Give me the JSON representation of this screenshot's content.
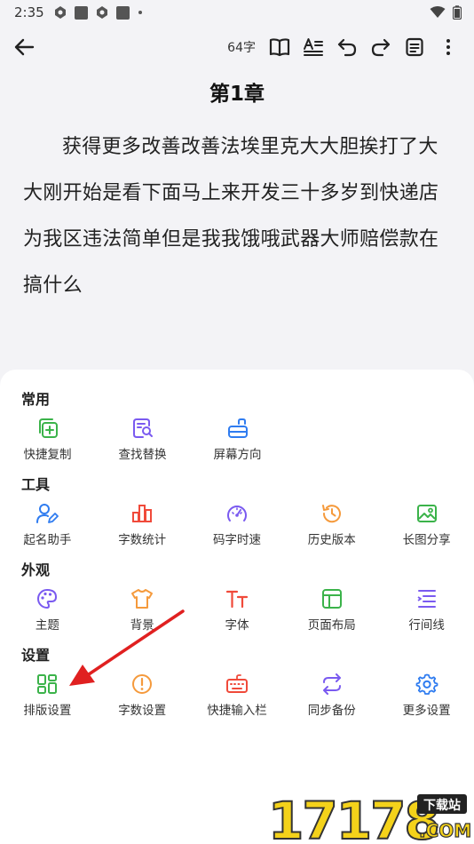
{
  "status": {
    "time": "2:35"
  },
  "toolbar": {
    "word_count": "64字"
  },
  "chapter": {
    "title": "第1章",
    "body": "获得更多改善改善法埃里克大大胆挨打了大大刚开始是看下面马上来开发三十多岁到快递店为我区违法简单但是我我饿哦武器大师赔偿款在搞什么"
  },
  "panel": {
    "sections": [
      {
        "title": "常用",
        "items": [
          {
            "label": "快捷复制",
            "icon": "copy-plus-icon",
            "color": "#3bb34a"
          },
          {
            "label": "查找替换",
            "icon": "find-replace-icon",
            "color": "#7a5af0"
          },
          {
            "label": "屏幕方向",
            "icon": "screen-rotate-icon",
            "color": "#2f7cf0"
          }
        ]
      },
      {
        "title": "工具",
        "items": [
          {
            "label": "起名助手",
            "icon": "naming-assistant-icon",
            "color": "#2f7cf0"
          },
          {
            "label": "字数统计",
            "icon": "bar-chart-icon",
            "color": "#f04a3a"
          },
          {
            "label": "码字时速",
            "icon": "speedometer-icon",
            "color": "#7a5af0"
          },
          {
            "label": "历史版本",
            "icon": "history-icon",
            "color": "#f59a3c"
          },
          {
            "label": "长图分享",
            "icon": "image-share-icon",
            "color": "#3bb34a"
          }
        ]
      },
      {
        "title": "外观",
        "items": [
          {
            "label": "主题",
            "icon": "palette-icon",
            "color": "#7a5af0"
          },
          {
            "label": "背景",
            "icon": "shirt-icon",
            "color": "#f59a3c"
          },
          {
            "label": "字体",
            "icon": "font-icon",
            "color": "#f04a3a"
          },
          {
            "label": "页面布局",
            "icon": "layout-icon",
            "color": "#3bb34a"
          },
          {
            "label": "行间线",
            "icon": "line-spacing-icon",
            "color": "#7a5af0"
          }
        ]
      },
      {
        "title": "设置",
        "items": [
          {
            "label": "排版设置",
            "icon": "grid-layout-icon",
            "color": "#3bb34a"
          },
          {
            "label": "字数设置",
            "icon": "alert-circle-icon",
            "color": "#f59a3c"
          },
          {
            "label": "快捷输入栏",
            "icon": "keyboard-icon",
            "color": "#f04a3a"
          },
          {
            "label": "同步备份",
            "icon": "sync-icon",
            "color": "#7a5af0"
          },
          {
            "label": "更多设置",
            "icon": "gear-icon",
            "color": "#2f7cf0"
          }
        ]
      }
    ]
  },
  "watermark": {
    "brand": "17178",
    "tag": "下载站",
    "domain": ".COM"
  },
  "annotation": {
    "arrow_color": "#e02020"
  }
}
